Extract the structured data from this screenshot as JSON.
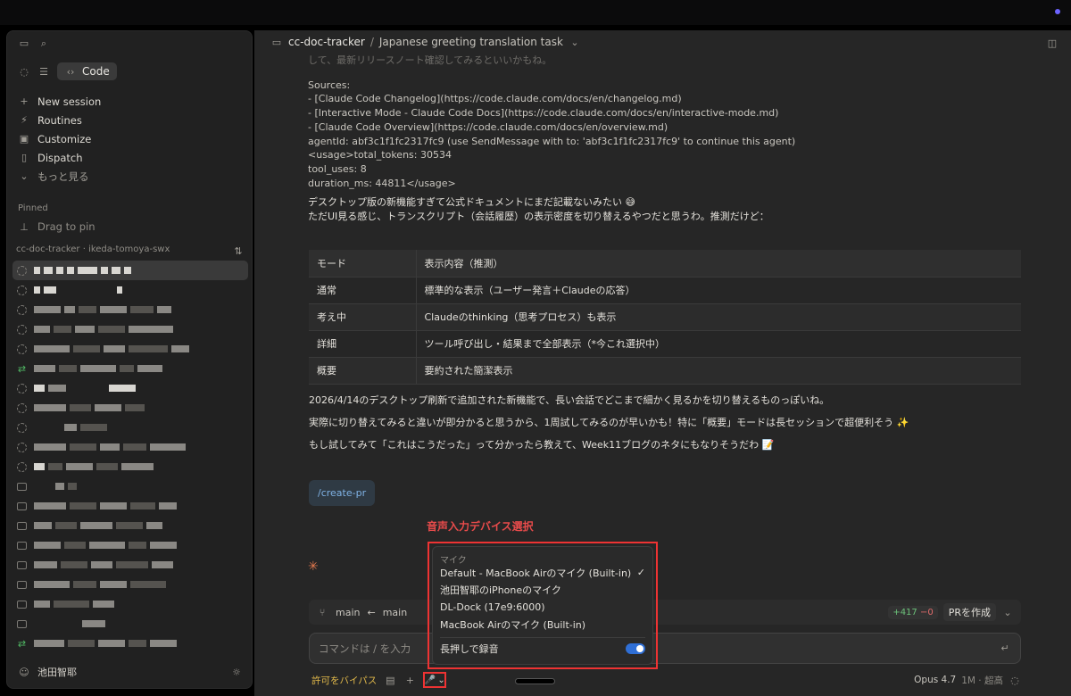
{
  "sidebar": {
    "mode_label": "Code",
    "nav": [
      {
        "icon": "plus-icon",
        "label": "New session"
      },
      {
        "icon": "routines-icon",
        "label": "Routines"
      },
      {
        "icon": "customize-icon",
        "label": "Customize"
      },
      {
        "icon": "dispatch-icon",
        "label": "Dispatch"
      },
      {
        "icon": "chevron-down-icon",
        "label": "もっと見る"
      }
    ],
    "pinned_label": "Pinned",
    "drag_label": "Drag to pin",
    "repo_label": "cc-doc-tracker · ikeda-tomoya-swx",
    "user_name": "池田智耶"
  },
  "header": {
    "repo": "cc-doc-tracker",
    "separator": "/",
    "task": "Japanese greeting translation task"
  },
  "chat": {
    "faded_line": "して、最新リリースノート確認してみるといいかもね。",
    "sources_label": "Sources:",
    "sources": [
      "- [Claude Code Changelog](https://code.claude.com/docs/en/changelog.md)",
      "- [Interactive Mode - Claude Code Docs](https://code.claude.com/docs/en/interactive-mode.md)",
      "- [Claude Code Overview](https://code.claude.com/docs/en/overview.md)"
    ],
    "agent_line": "agentId: abf3c1f1fc2317fc9 (use SendMessage with to: 'abf3c1f1fc2317fc9' to continue this agent)",
    "usage_line": "<usage>total_tokens: 30534",
    "tool_uses": "tool_uses: 8",
    "duration": "duration_ms: 44811</usage>",
    "line1": "デスクトップ版の新機能すぎて公式ドキュメントにまだ記載ないみたい 😅",
    "line2": "ただUI見る感じ、トランスクリプト（会話履歴）の表示密度を切り替えるやつだと思うわ。推測だけど：",
    "table": {
      "headers": [
        "モード",
        "表示内容（推測）"
      ],
      "rows": [
        [
          "通常",
          "標準的な表示（ユーザー発言＋Claudeの応答）"
        ],
        [
          "考え中",
          "Claudeのthinking（思考プロセス）も表示"
        ],
        [
          "詳細",
          "ツール呼び出し・結果まで全部表示（*今これ選択中）"
        ],
        [
          "概要",
          "要約された簡潔表示"
        ]
      ]
    },
    "after1": "2026/4/14のデスクトップ刷新で追加された新機能で、長い会話でどこまで細かく見るかを切り替えるものっぽいね。",
    "after2": "実際に切り替えてみると違いが即分かると思うから、1周試してみるのが早いかも！特に「概要」モードは長セッションで超便利そう ✨",
    "after3": "もし試してみて「これはこうだった」って分かったら教えて、Week11ブログのネタにもなりそうだわ 📝",
    "command_chip": "/create-pr"
  },
  "annotation": "音声入力デバイス選択",
  "mic_menu": {
    "section_label": "マイク",
    "devices": [
      {
        "label": "Default - MacBook Airのマイク (Built-in)",
        "check": "✓"
      },
      {
        "label": "池田智耶のiPhoneのマイク",
        "check": ""
      },
      {
        "label": "DL-Dock (17e9:6000)",
        "check": ""
      },
      {
        "label": "MacBook Airのマイク (Built-in)",
        "check": ""
      }
    ],
    "push_to_talk": "長押しで録音",
    "push_to_talk_on": true
  },
  "branch_bar": {
    "from": "main",
    "arrow": "←",
    "to": "main",
    "additions": "+417",
    "deletions": "−0",
    "pr_button": "PRを作成"
  },
  "composer": {
    "placeholder": "コマンドは / を入力"
  },
  "bottom": {
    "bypass": "許可をバイパス",
    "model": "Opus 4.7",
    "context": "1M · 超高"
  },
  "colors": {
    "accent_red": "#e33333",
    "bypass_yellow": "#e0b84a",
    "link_blue": "#7fb2e5",
    "toggle_blue": "#2f6fd6"
  }
}
